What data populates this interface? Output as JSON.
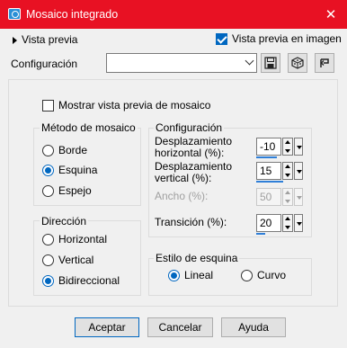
{
  "window": {
    "title": "Mosaico integrado",
    "close_glyph": "✕"
  },
  "top": {
    "preview_label": "Vista previa",
    "preview_in_image_label": "Vista previa en imagen",
    "preview_in_image_checked": true,
    "config_label": "Configuración",
    "config_value": ""
  },
  "options": {
    "show_mosaic_preview_label": "Mostrar vista previa de mosaico",
    "show_mosaic_preview_checked": false
  },
  "method": {
    "title": "Método de mosaico",
    "options": [
      "Borde",
      "Esquina",
      "Espejo"
    ],
    "selected": "Esquina"
  },
  "configuration": {
    "title": "Configuración",
    "fields": [
      {
        "label_line1": "Desplazamiento",
        "label_line2": "horizontal (%):",
        "value": "-10",
        "enabled": true,
        "level": 0.45
      },
      {
        "label_line1": "Desplazamiento",
        "label_line2": "vertical (%):",
        "value": "15",
        "enabled": true,
        "level": 0.57
      },
      {
        "label_line1": "Ancho (%):",
        "label_line2": "",
        "value": "50",
        "enabled": false,
        "level": 0.5
      },
      {
        "label_line1": "Transición (%):",
        "label_line2": "",
        "value": "20",
        "enabled": true,
        "level": 0.2
      }
    ]
  },
  "direction": {
    "title": "Dirección",
    "options": [
      "Horizontal",
      "Vertical",
      "Bidireccional"
    ],
    "selected": "Bidireccional"
  },
  "corner_style": {
    "title": "Estilo de esquina",
    "options": [
      "Lineal",
      "Curvo"
    ],
    "selected": "Lineal"
  },
  "buttons": {
    "accept": "Aceptar",
    "cancel": "Cancelar",
    "help": "Ayuda"
  },
  "colors": {
    "title_bar": "#e81123",
    "accent": "#0067c0"
  }
}
